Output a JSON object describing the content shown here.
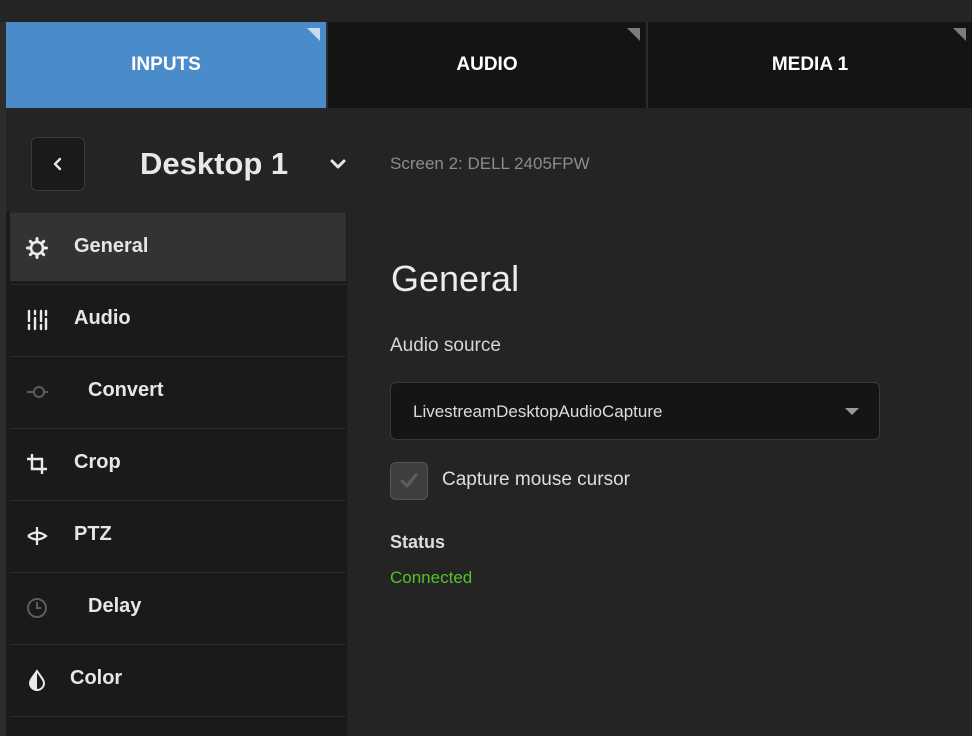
{
  "tabs": [
    {
      "label": "INPUTS",
      "active": true
    },
    {
      "label": "AUDIO",
      "active": false
    },
    {
      "label": "MEDIA 1",
      "active": false
    }
  ],
  "header": {
    "input_name": "Desktop 1",
    "screen_desc": "Screen 2: DELL 2405FPW"
  },
  "sidebar": {
    "items": [
      {
        "label": "General",
        "icon": "gear-icon",
        "active": true
      },
      {
        "label": "Audio",
        "icon": "audio-mixer-icon",
        "active": false
      },
      {
        "label": "Convert",
        "icon": "convert-icon",
        "active": false
      },
      {
        "label": "Crop",
        "icon": "crop-icon",
        "active": false
      },
      {
        "label": "PTZ",
        "icon": "ptz-icon",
        "active": false
      },
      {
        "label": "Delay",
        "icon": "clock-icon",
        "active": false
      },
      {
        "label": "Color",
        "icon": "color-drop-icon",
        "active": false
      }
    ]
  },
  "panel": {
    "title": "General",
    "audio_source_label": "Audio source",
    "audio_source_value": "LivestreamDesktopAudioCapture",
    "capture_cursor_label": "Capture mouse cursor",
    "capture_cursor_checked": true,
    "status_label": "Status",
    "status_value": "Connected"
  },
  "colors": {
    "accent": "#4a8cc9",
    "status_ok": "#55c22a",
    "background": "#242424"
  }
}
